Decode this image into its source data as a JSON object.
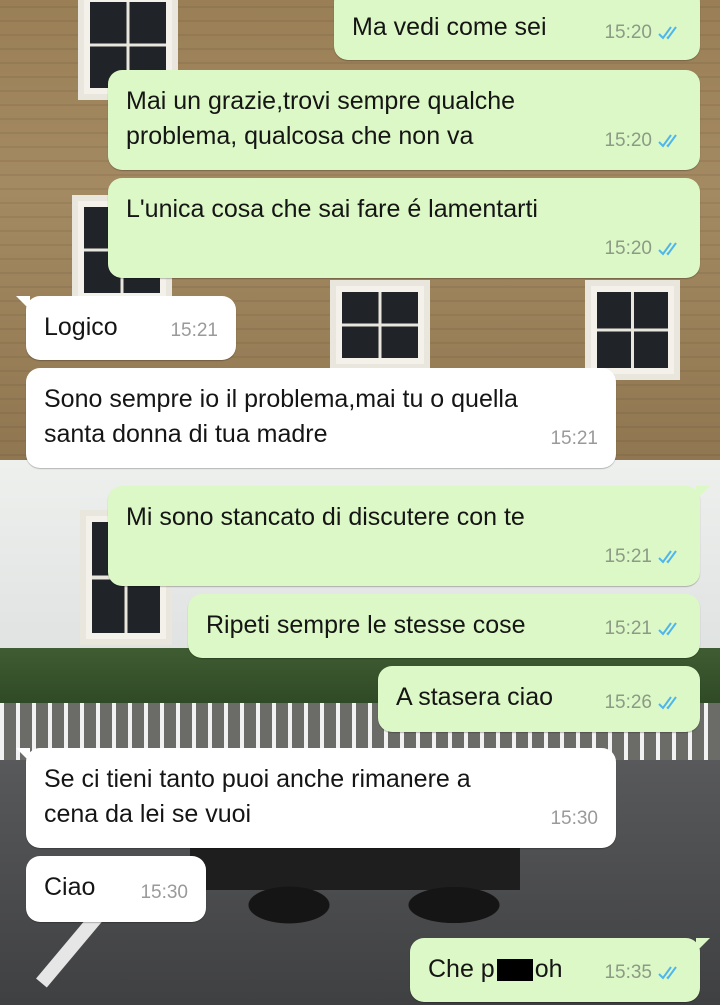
{
  "colors": {
    "outgoing_bubble": "#dcf8c6",
    "incoming_bubble": "#ffffff",
    "read_ticks": "#4fb6ec"
  },
  "messages": [
    {
      "dir": "out",
      "text": "Ma vedi come sei",
      "time": "15:20",
      "read": true
    },
    {
      "dir": "out",
      "text": "Mai un grazie,trovi sempre qualche\nproblema, qualcosa che non va",
      "time": "15:20",
      "read": true
    },
    {
      "dir": "out",
      "text": "L'unica cosa che sai fare é lamentarti",
      "time": "15:20",
      "read": true
    },
    {
      "dir": "in",
      "text": "Logico",
      "time": "15:21"
    },
    {
      "dir": "in",
      "text": "Sono sempre io il problema,mai tu o quella\nsanta donna di tua madre",
      "time": "15:21"
    },
    {
      "dir": "out",
      "text": "Mi sono stancato di discutere con te",
      "time": "15:21",
      "read": true
    },
    {
      "dir": "out",
      "text": "Ripeti sempre le stesse cose",
      "time": "15:21",
      "read": true
    },
    {
      "dir": "out",
      "text": "A stasera ciao",
      "time": "15:26",
      "read": true
    },
    {
      "dir": "in",
      "text": "Se ci tieni tanto puoi anche rimanere a\ncena da lei se vuoi",
      "time": "15:30"
    },
    {
      "dir": "in",
      "text": "Ciao",
      "time": "15:30"
    },
    {
      "dir": "out",
      "text_before": "Che p",
      "text_after": "oh",
      "redacted": true,
      "time": "15:35",
      "read": true
    }
  ],
  "icons": {
    "read_receipt": "double-check-icon",
    "redaction": "censor-bar"
  }
}
